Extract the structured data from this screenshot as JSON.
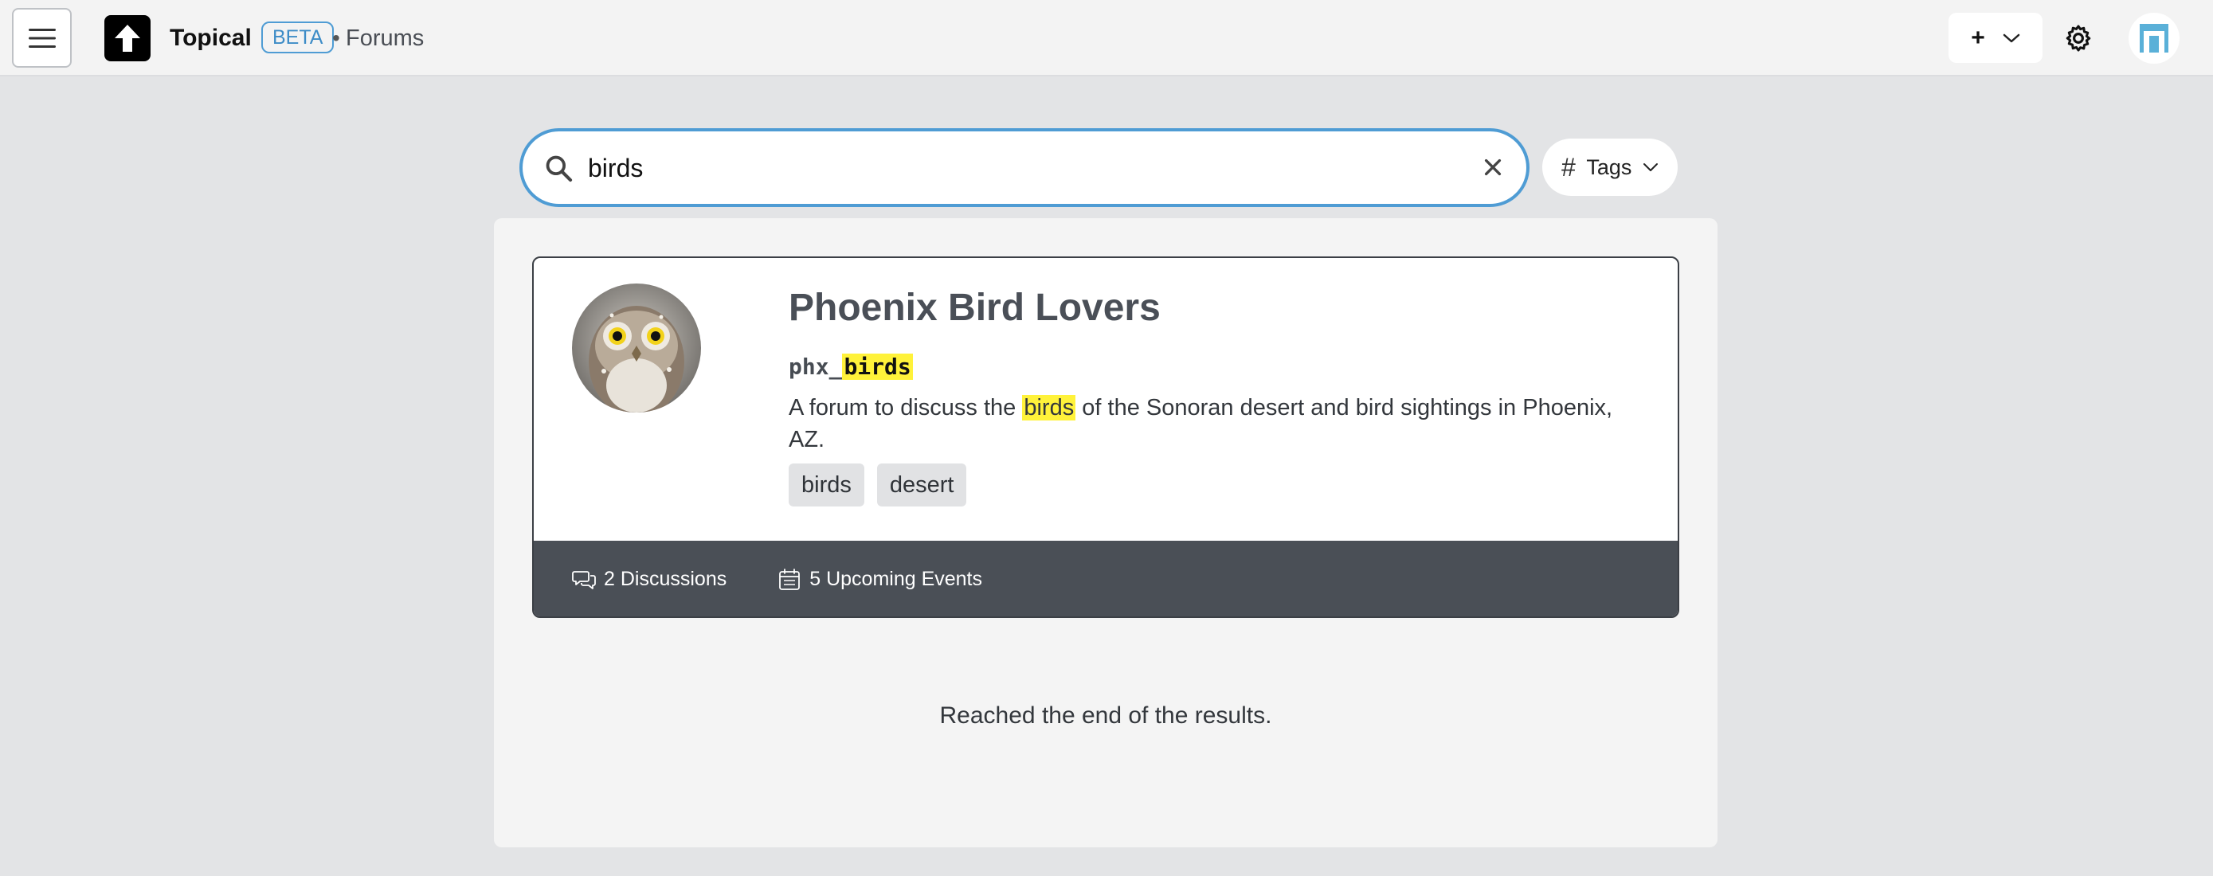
{
  "header": {
    "brand": "Topical",
    "badge": "BETA",
    "separator": "•",
    "breadcrumb": "Forums",
    "new_label": "+",
    "icons": [
      "menu-icon",
      "topical-logo-icon",
      "chevron-down-icon",
      "gear-icon",
      "avatar-icon"
    ]
  },
  "search": {
    "value": "birds",
    "placeholder": "",
    "icons": [
      "search-icon",
      "close-icon"
    ]
  },
  "tags_filter": {
    "hash": "#",
    "label": "Tags"
  },
  "results": [
    {
      "title": "Phoenix Bird Lovers",
      "handle_prefix": "phx_",
      "handle_match": "birds",
      "description_before": "A forum to discuss the ",
      "description_match": "birds",
      "description_after": " of the Sonoran desert and bird sightings in Phoenix, AZ.",
      "tags": [
        "birds",
        "desert"
      ],
      "discussions": "2 Discussions",
      "events": "5 Upcoming Events"
    }
  ],
  "end_message": "Reached the end of the results.",
  "colors": {
    "accent": "#4f9cd4",
    "highlight": "#fff23a",
    "footer": "#4a4f56",
    "background": "#e3e4e6"
  }
}
